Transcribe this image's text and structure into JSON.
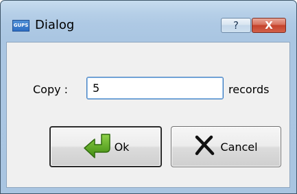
{
  "window": {
    "title": "Dialog",
    "app_icon_text": "GUPS",
    "help_label": "?",
    "close_label": "X"
  },
  "form": {
    "copy_label": "Copy :",
    "copy_count_value": "5",
    "records_label": "records"
  },
  "buttons": {
    "ok_label": "Ok",
    "ok_icon": "green-return-arrow-icon",
    "cancel_label": "Cancel",
    "cancel_icon": "black-x-icon"
  },
  "colors": {
    "frame": "#a9c5e1",
    "client": "#f0f0f0",
    "close_button": "#c4432b",
    "ok_arrow": "#4fa012"
  }
}
